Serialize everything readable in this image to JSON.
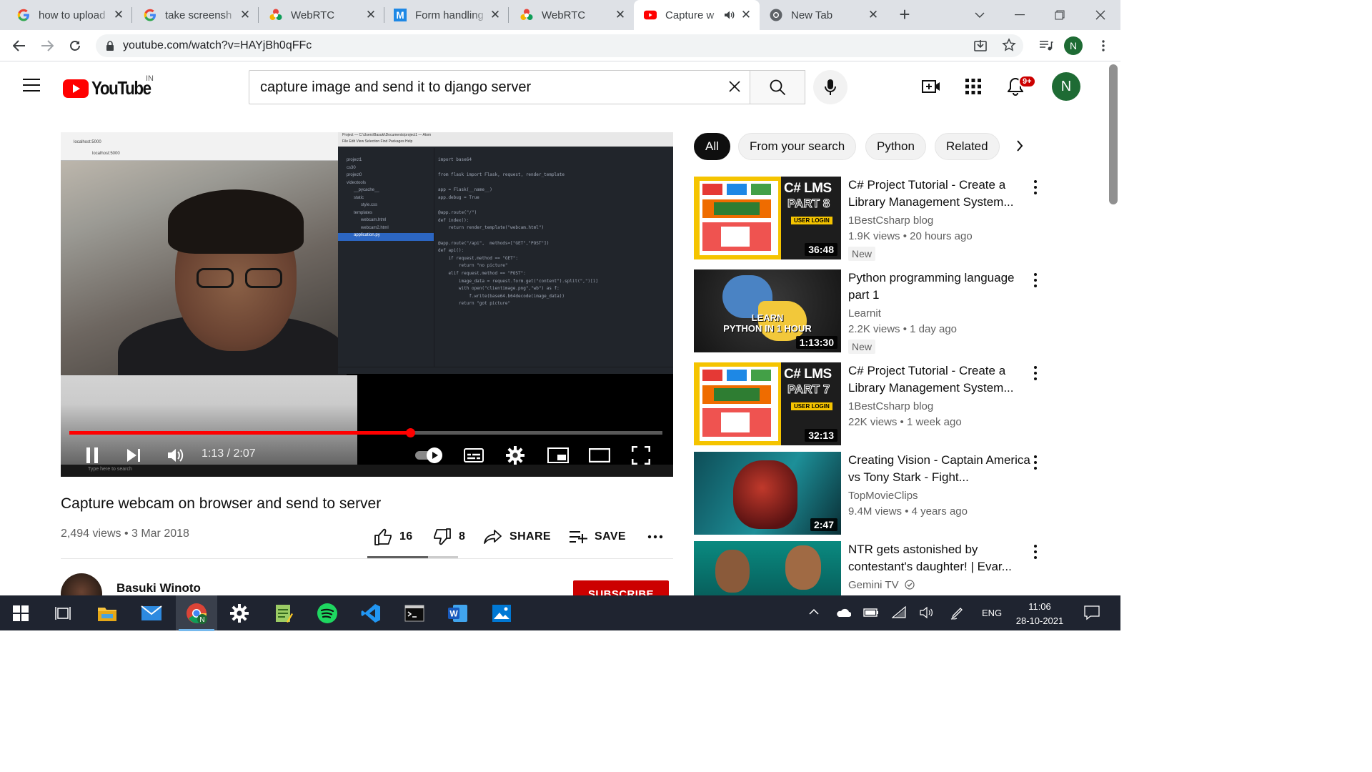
{
  "browser": {
    "tabs": [
      {
        "title": "how to upload",
        "icon": "google-icon"
      },
      {
        "title": "take screensh",
        "icon": "google-icon"
      },
      {
        "title": "WebRTC",
        "icon": "webrtc-icon"
      },
      {
        "title": "Form handling",
        "icon": "m-icon"
      },
      {
        "title": "WebRTC",
        "icon": "webrtc-icon"
      },
      {
        "title": "Capture w",
        "icon": "youtube-icon",
        "active": true
      },
      {
        "title": "New Tab",
        "icon": "chrome-icon"
      }
    ],
    "url": "youtube.com/watch?v=HAYjBh0qFFc",
    "profile_initial": "N"
  },
  "youtube": {
    "country_code": "IN",
    "wordmark": "YouTube",
    "search_query": "capture image and send it to django server",
    "notification_count": "9+",
    "avatar_initial": "N"
  },
  "player": {
    "current_time": "1:13",
    "duration": "2:07",
    "time_display": "1:13 / 2:07",
    "progress_fraction": 0.575,
    "state": "playing"
  },
  "video": {
    "title": "Capture webcam on browser and send to server",
    "meta": "2,494 views • 3 Mar 2018",
    "likes": "16",
    "dislikes": "8",
    "share_label": "SHARE",
    "save_label": "SAVE",
    "channel": "Basuki Winoto",
    "subscribe_label": "SUBSCRIBE",
    "like_ratio": 0.67
  },
  "chips": [
    "All",
    "From your search",
    "Python",
    "Related"
  ],
  "recommendations": [
    {
      "title": "C# Project Tutorial - Create a Library Management System...",
      "channel": "1BestCsharp blog",
      "meta": "1.9K views • 20 hours ago",
      "badge": "New",
      "duration": "36:48",
      "thumb": "lms",
      "thumb_big": "C# LMS",
      "thumb_part": "PART 8",
      "thumb_sub": "USER LOGIN"
    },
    {
      "title": "Python programming language part 1",
      "channel": "Learnit",
      "meta": "2.2K views • 1 day ago",
      "badge": "New",
      "duration": "1:13:30",
      "thumb": "python",
      "thumb_line1": "LEARN",
      "thumb_line2": "PYTHON IN 1 HOUR"
    },
    {
      "title": "C# Project Tutorial - Create a Library Management System...",
      "channel": "1BestCsharp blog",
      "meta": "22K views • 1 week ago",
      "badge": "",
      "duration": "32:13",
      "thumb": "lms",
      "thumb_big": "C# LMS",
      "thumb_part": "PART 7",
      "thumb_sub": "USER LOGIN"
    },
    {
      "title": "Creating Vision - Captain America vs Tony Stark - Fight...",
      "channel": "TopMovieClips",
      "meta": "9.4M views • 4 years ago",
      "badge": "",
      "duration": "2:47",
      "thumb": "cap"
    },
    {
      "title": "NTR gets astonished by contestant's daughter! | Evar...",
      "channel": "Gemini TV",
      "meta": "",
      "badge": "",
      "duration": "",
      "thumb": "ntr",
      "verified": true
    }
  ],
  "inner_video": {
    "browser_tab": "localhost:5000",
    "browser_url": "localhost:5000",
    "atom_title": "Project — C:\\Users\\Basuki\\Documents\\project1 — Atom",
    "atom_menu": "File  Edit  View  Selection  Find  Packages  Help",
    "tree": [
      "project1",
      "cs30",
      "project0",
      "videotools",
      "__pycache__",
      "static",
      "style.css",
      "templates",
      "webcam.html",
      "webcam2.html",
      "application.py"
    ],
    "code": "import base64\n\nfrom flask import Flask, request, render_template\n\napp = Flask(__name__)\napp.debug = True\n\n@app.route(\"/\")\ndef index():\n    return render_template(\"webcam.html\")\n\n@app.route(\"/api\",  methods=[\"GET\",\"POST\"])\ndef api():\n    if request.method == \"GET\":\n        return \"no picture\"\n    elif request.method == \"POST\":\n        image_data = request.form.get(\"content\").split(\",\")[1]\n        with open(\"clientimage.png\",\"wb\") as f:\n            f.write(base64.b64decode(image_data))\n        return \"got picture\"\n",
    "taskbar_search": "Type here to search"
  },
  "taskbar": {
    "language": "ENG",
    "time": "11:06",
    "date": "28-10-2021"
  },
  "colors": {
    "youtube_red": "#ff0000",
    "subscribe_red": "#cc0000",
    "avatar_green": "#1e6b34"
  }
}
